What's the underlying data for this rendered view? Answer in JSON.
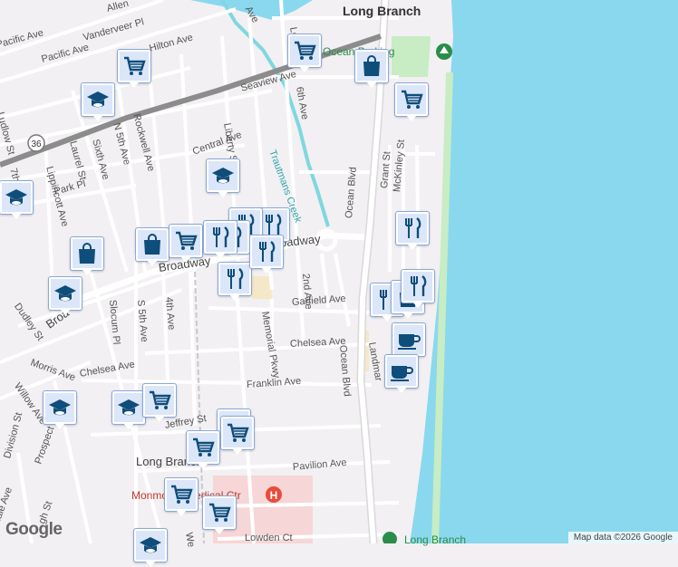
{
  "map": {
    "attribution": "Map data ©2026 Google",
    "logo_text": "Google",
    "colors": {
      "ocean": "#8ad8ee",
      "land": "#f2f0f2",
      "road": "#ffffff",
      "highway": "#8c8c8c",
      "park": "#c8ecc4",
      "medical": "#f6d6d6",
      "creek": "#7fd7e0",
      "shopping": "#f5e8c8",
      "icon": "#0f4d7a",
      "pin_bg": "#dbe6f8"
    },
    "labels": {
      "long_branch_top": "Long Branch",
      "long_branch_mid": "Long Branch",
      "long_branch_bottom": "Long Branch",
      "ocean_parking": "Ocean Parking",
      "monmouth_medical": "Monmouth Medical Ctr",
      "trautmans_creek": "Trautmans Creek",
      "broadway": "Broadway",
      "broadway_east": "Broadway",
      "broadway_west": "Broa",
      "ocean_blvd_north": "Ocean Blvd",
      "ocean_blvd_south": "Ocean Blvd",
      "garfield_ave": "Garfield Ave",
      "chelsea_ave": "Chelsea Ave",
      "chelsea_ave_west": "Chelsea Ave",
      "franklin_ave": "Franklin Ave",
      "pavilion_ave": "Pavilion Ave",
      "lowden_ct": "Lowden Ct",
      "memorial_pkwy": "Memorial Pkwy",
      "second_ave": "2nd Ave",
      "fourth_ave": "4th Ave",
      "s_fifth_ave": "S 5th Ave",
      "slocum_pl": "Slocum Pl",
      "dudley_st": "Dudley St",
      "morris_ave": "Morris Ave",
      "willow_ave": "Willow Ave",
      "division_st": "Division St",
      "prospect_st": "Prospect St",
      "jeffrey_st": "Jeffrey St",
      "park_pl": "Park Pl",
      "seventh_ave": "7th Ave",
      "lippincott_ave": "Lippincott Ave",
      "laurel_st": "Laurel St",
      "sixth_ave": "Sixth Ave",
      "n_fifth_ave": "N 5th Ave",
      "rockwell_ave": "Rockwell Ave",
      "ludlow_st": "Ludlow St",
      "central_ave": "Central Ave",
      "liberty_st": "Liberty St",
      "seaview_ave": "Seaview Ave",
      "pacific_ave": "Pacific Ave",
      "pacific_ave_west": "Pacific Ave",
      "vanderveer_pl": "Vanderveer Pl",
      "hilton_ave": "Hilton Ave",
      "allen": "Allen",
      "grant_st": "Grant St",
      "mckinley_st": "McKinley St",
      "landmark": "Landmar",
      "route_36": "36",
      "ave_top": "Ave",
      "sixth_ave_n": "6th Ave",
      "lo": "Lo",
      "westwood": "We",
      "dale": "dale Ave",
      "high_st": "gh St"
    },
    "pins": [
      {
        "icon": "shopping-cart-icon"
      },
      {
        "icon": "shopping-bag-icon"
      },
      {
        "icon": "shopping-cart-icon"
      },
      {
        "icon": "school-icon"
      },
      {
        "icon": "shopping-cart-icon"
      },
      {
        "icon": "school-icon"
      },
      {
        "icon": "school-icon"
      },
      {
        "icon": "restaurant-icon"
      },
      {
        "icon": "restaurant-icon"
      },
      {
        "icon": "restaurant-icon"
      },
      {
        "icon": "restaurant-icon"
      },
      {
        "icon": "shopping-bag-icon"
      },
      {
        "icon": "shopping-cart-icon"
      },
      {
        "icon": "restaurant-icon"
      },
      {
        "icon": "restaurant-icon"
      },
      {
        "icon": "shopping-bag-icon"
      },
      {
        "icon": "restaurant-icon"
      },
      {
        "icon": "school-icon"
      },
      {
        "icon": "restaurant-icon"
      },
      {
        "icon": "shopping-bag-icon"
      },
      {
        "icon": "restaurant-icon"
      },
      {
        "icon": "coffee-icon"
      },
      {
        "icon": "coffee-icon"
      },
      {
        "icon": "school-icon"
      },
      {
        "icon": "school-icon"
      },
      {
        "icon": "shopping-cart-icon"
      },
      {
        "icon": "shopping-cart-icon"
      },
      {
        "icon": "shopping-cart-icon"
      },
      {
        "icon": "shopping-cart-icon"
      },
      {
        "icon": "shopping-cart-icon"
      },
      {
        "icon": "shopping-cart-icon"
      },
      {
        "icon": "school-icon"
      }
    ]
  }
}
